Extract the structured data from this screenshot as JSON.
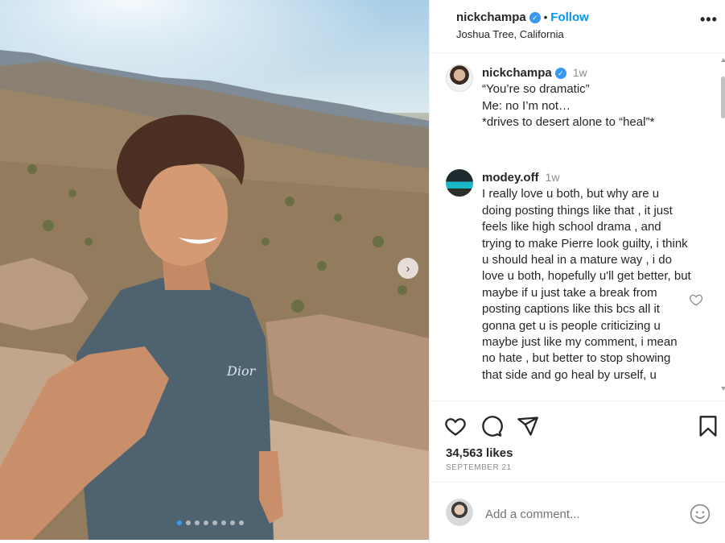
{
  "post": {
    "username": "nickchampa",
    "follow_label": "Follow",
    "location": "Joshua Tree, California",
    "more_label": "•••",
    "carousel": {
      "slide_count": 8,
      "active_index": 0
    }
  },
  "caption": {
    "username": "nickchampa",
    "time": "1w",
    "text": "“You’re so dramatic”\nMe: no I’m not…\n*drives to desert alone to “heal”*"
  },
  "comments": [
    {
      "username": "modey.off",
      "time": "1w",
      "text": "I really love u both, but why are u doing posting things like that , it just feels like high school drama , and trying to make Pierre look guilty, i think u should heal in a mature way , i do love u both, hopefully u'll get better, but maybe if u just take a break from posting captions like this bcs all it gonna get u is people criticizing u maybe just like my comment, i mean no hate , but better to stop showing that side and go heal by urself, u"
    }
  ],
  "engagement": {
    "likes": "34,563 likes",
    "date": "SEPTEMBER 21"
  },
  "add_comment": {
    "placeholder": "Add a comment..."
  },
  "icons": {
    "verified": "verified-badge-icon",
    "like": "heart-icon",
    "comment": "comment-bubble-icon",
    "share": "paper-plane-icon",
    "save": "bookmark-icon",
    "emoji": "emoji-smiley-icon",
    "next": "chevron-right-icon"
  },
  "colors": {
    "accent": "#0095f6",
    "verified": "#3897f0",
    "text": "#262626",
    "muted": "#8e8e8e"
  }
}
